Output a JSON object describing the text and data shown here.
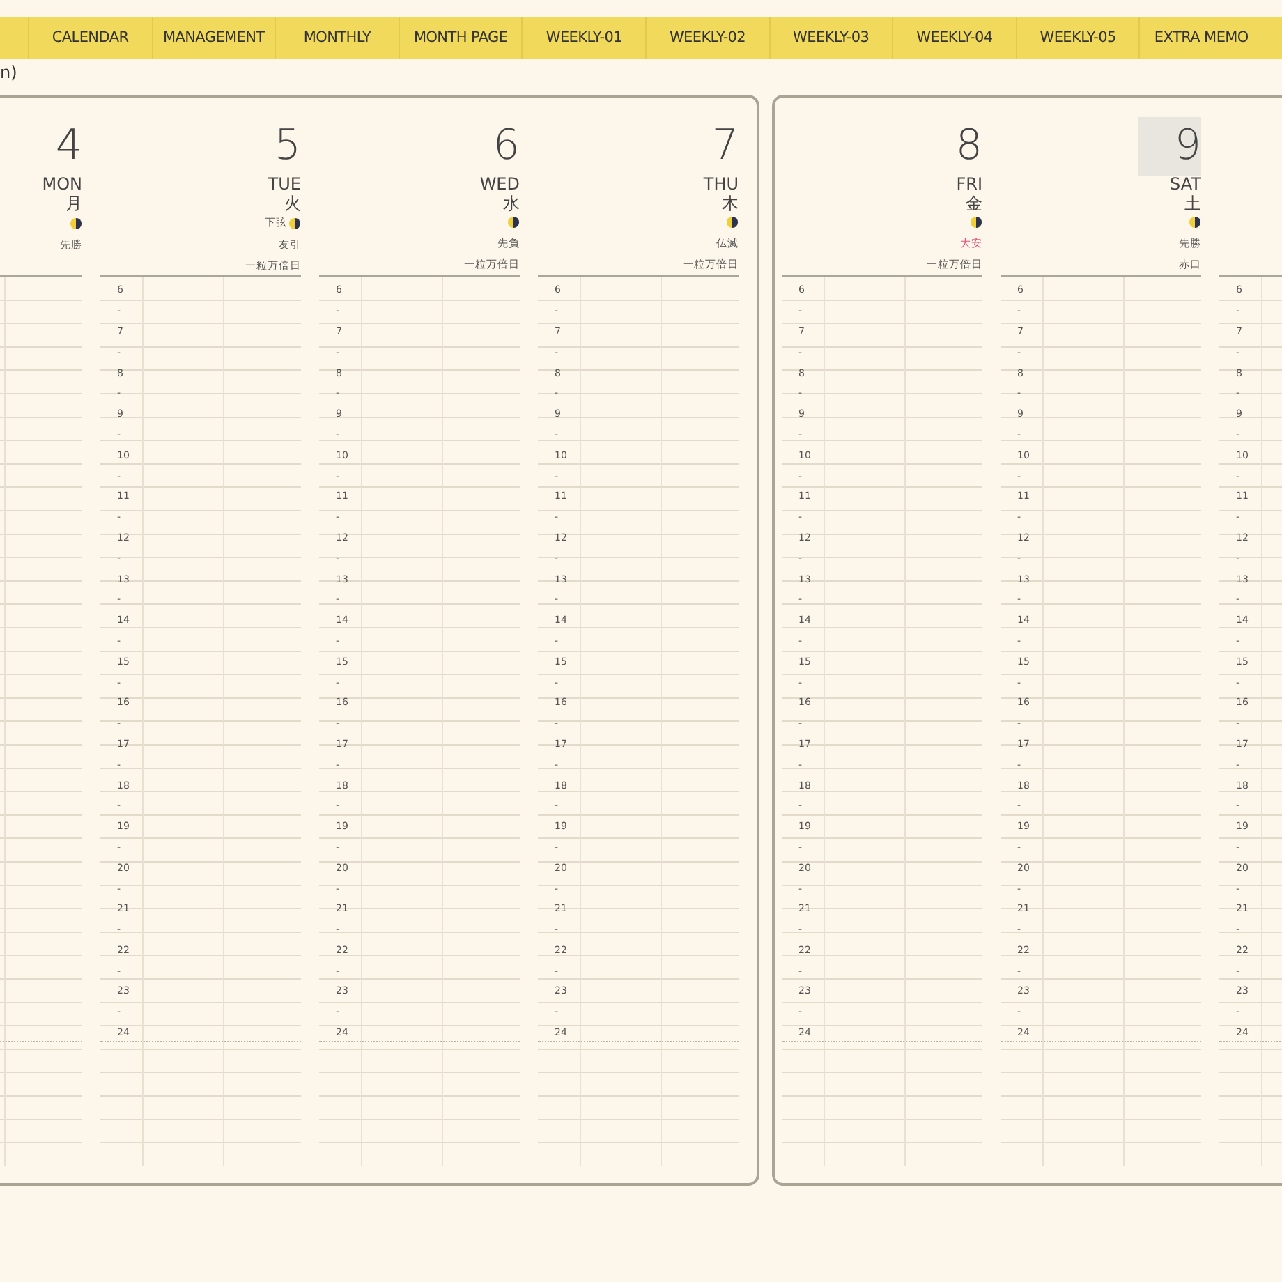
{
  "tabs": [
    {
      "label": "CALENDAR",
      "selected": false
    },
    {
      "label": "MANAGEMENT",
      "selected": false
    },
    {
      "label": "MONTHLY",
      "selected": false
    },
    {
      "label": "MONTH PAGE",
      "selected": false
    },
    {
      "label": "WEEKLY-01",
      "selected": false
    },
    {
      "label": "WEEKLY-02",
      "selected": false
    },
    {
      "label": "WEEKLY-03",
      "selected": false
    },
    {
      "label": "WEEKLY-04",
      "selected": false
    },
    {
      "label": "WEEKLY-05",
      "selected": false
    },
    {
      "label": "EXTRA MEMO",
      "selected": false
    }
  ],
  "page_caption": "n)",
  "pages": [
    {
      "days": [
        {
          "kind": "day",
          "date": "4",
          "weekday": "MON",
          "kanji": "月",
          "highlighted": false,
          "rokuyo": {
            "text": "先勝",
            "color": "#555555"
          }
        },
        {
          "kind": "day",
          "date": "5",
          "weekday": "TUE",
          "kanji": "火",
          "highlighted": false,
          "moon_label": "下弦",
          "rokuyo": {
            "text": "友引",
            "color": "#555555"
          },
          "extra": "一粒万倍日",
          "hours": [
            "6",
            "-",
            "7",
            "-",
            "8",
            "-",
            "9",
            "-",
            "10",
            "-",
            "11",
            "-",
            "12",
            "-",
            "13",
            "-",
            "14",
            "-",
            "15",
            "-",
            "16",
            "-",
            "17",
            "-",
            "18",
            "-",
            "19",
            "-",
            "20",
            "-",
            "21",
            "-",
            "22",
            "-",
            "23",
            "-",
            "24"
          ]
        },
        {
          "kind": "day",
          "date": "6",
          "weekday": "WED",
          "kanji": "水",
          "highlighted": false,
          "rokuyo": {
            "text": "先負",
            "color": "#555555"
          },
          "extra": "一粒万倍日",
          "hours": [
            "6",
            "-",
            "7",
            "-",
            "8",
            "-",
            "9",
            "-",
            "10",
            "-",
            "11",
            "-",
            "12",
            "-",
            "13",
            "-",
            "14",
            "-",
            "15",
            "-",
            "16",
            "-",
            "17",
            "-",
            "18",
            "-",
            "19",
            "-",
            "20",
            "-",
            "21",
            "-",
            "22",
            "-",
            "23",
            "-",
            "24"
          ]
        },
        {
          "kind": "day",
          "date": "7",
          "weekday": "THU",
          "kanji": "木",
          "highlighted": false,
          "rokuyo": {
            "text": "仏滅",
            "color": "#555555"
          },
          "extra": "一粒万倍日",
          "hours": [
            "6",
            "-",
            "7",
            "-",
            "8",
            "-",
            "9",
            "-",
            "10",
            "-",
            "11",
            "-",
            "12",
            "-",
            "13",
            "-",
            "14",
            "-",
            "15",
            "-",
            "16",
            "-",
            "17",
            "-",
            "18",
            "-",
            "19",
            "-",
            "20",
            "-",
            "21",
            "-",
            "22",
            "-",
            "23",
            "-",
            "24"
          ]
        }
      ]
    },
    {
      "days": [
        {
          "kind": "day",
          "date": "8",
          "weekday": "FRI",
          "kanji": "金",
          "highlighted": false,
          "rokuyo": {
            "text": "大安",
            "color": "#e8507a"
          },
          "extra": "一粒万倍日",
          "hours": [
            "6",
            "-",
            "7",
            "-",
            "8",
            "-",
            "9",
            "-",
            "10",
            "-",
            "11",
            "-",
            "12",
            "-",
            "13",
            "-",
            "14",
            "-",
            "15",
            "-",
            "16",
            "-",
            "17",
            "-",
            "18",
            "-",
            "19",
            "-",
            "20",
            "-",
            "21",
            "-",
            "22",
            "-",
            "23",
            "-",
            "24"
          ]
        },
        {
          "kind": "day",
          "date": "9",
          "weekday": "SAT",
          "kanji": "土",
          "highlighted": true,
          "rokuyo": {
            "text": "先勝",
            "color": "#555555"
          },
          "extra": "赤口",
          "hours": [
            "6",
            "-",
            "7",
            "-",
            "8",
            "-",
            "9",
            "-",
            "10",
            "-",
            "11",
            "-",
            "12",
            "-",
            "13",
            "-",
            "14",
            "-",
            "15",
            "-",
            "16",
            "-",
            "17",
            "-",
            "18",
            "-",
            "19",
            "-",
            "20",
            "-",
            "21",
            "-",
            "22",
            "-",
            "23",
            "-",
            "24"
          ]
        },
        {
          "kind": "blank",
          "hours": [
            "6",
            "-",
            "7",
            "-",
            "8",
            "-",
            "9",
            "-",
            "10",
            "-",
            "11",
            "-",
            "12",
            "-",
            "13",
            "-",
            "14",
            "-",
            "15",
            "-",
            "16",
            "-",
            "17",
            "-",
            "18",
            "-",
            "19",
            "-",
            "20",
            "-",
            "21",
            "-",
            "22",
            "-",
            "23",
            "-",
            "24"
          ]
        }
      ]
    }
  ]
}
